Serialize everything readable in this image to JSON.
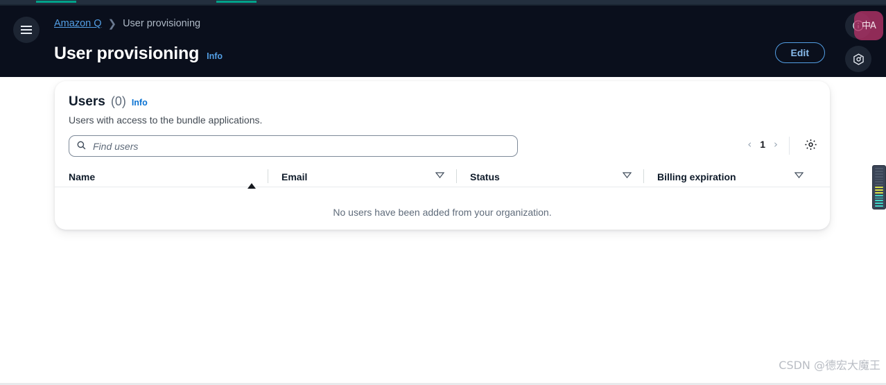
{
  "chrome": {
    "tab_accent_color": "#00a28a",
    "strip_bg": "#232f3e"
  },
  "header": {
    "nav_toggle_name": "hamburger-menu",
    "breadcrumb": {
      "parent": "Amazon Q",
      "separator": "❯",
      "current": "User provisioning"
    },
    "title": "User provisioning",
    "title_info_label": "Info",
    "edit_label": "Edit",
    "accent_link_color": "#539fe5",
    "bg_color": "#0a0f1c"
  },
  "corner_buttons": {
    "info_tooltip": "Info",
    "shield_tooltip": "Settings",
    "translate_label": "中A",
    "translate_bg": "#b23266"
  },
  "card": {
    "title": "Users",
    "count": "(0)",
    "info_label": "Info",
    "subtitle": "Users with access to the bundle applications.",
    "search": {
      "placeholder": "Find users",
      "value": ""
    },
    "pagination": {
      "prev": "‹",
      "page": "1",
      "next": "›"
    },
    "settings_icon": "gear-icon",
    "table": {
      "columns": [
        {
          "label": "Name",
          "sort": "asc"
        },
        {
          "label": "Email",
          "sort": "none"
        },
        {
          "label": "Status",
          "sort": "none"
        },
        {
          "label": "Billing expiration",
          "sort": "none"
        }
      ],
      "empty_message": "No users have been added from your organization."
    }
  },
  "level_meter": {
    "segments_total": 15,
    "segments_cyan": 5,
    "segments_yellow": 3
  },
  "watermark": {
    "text": "CSDN @德宏大魔王"
  }
}
